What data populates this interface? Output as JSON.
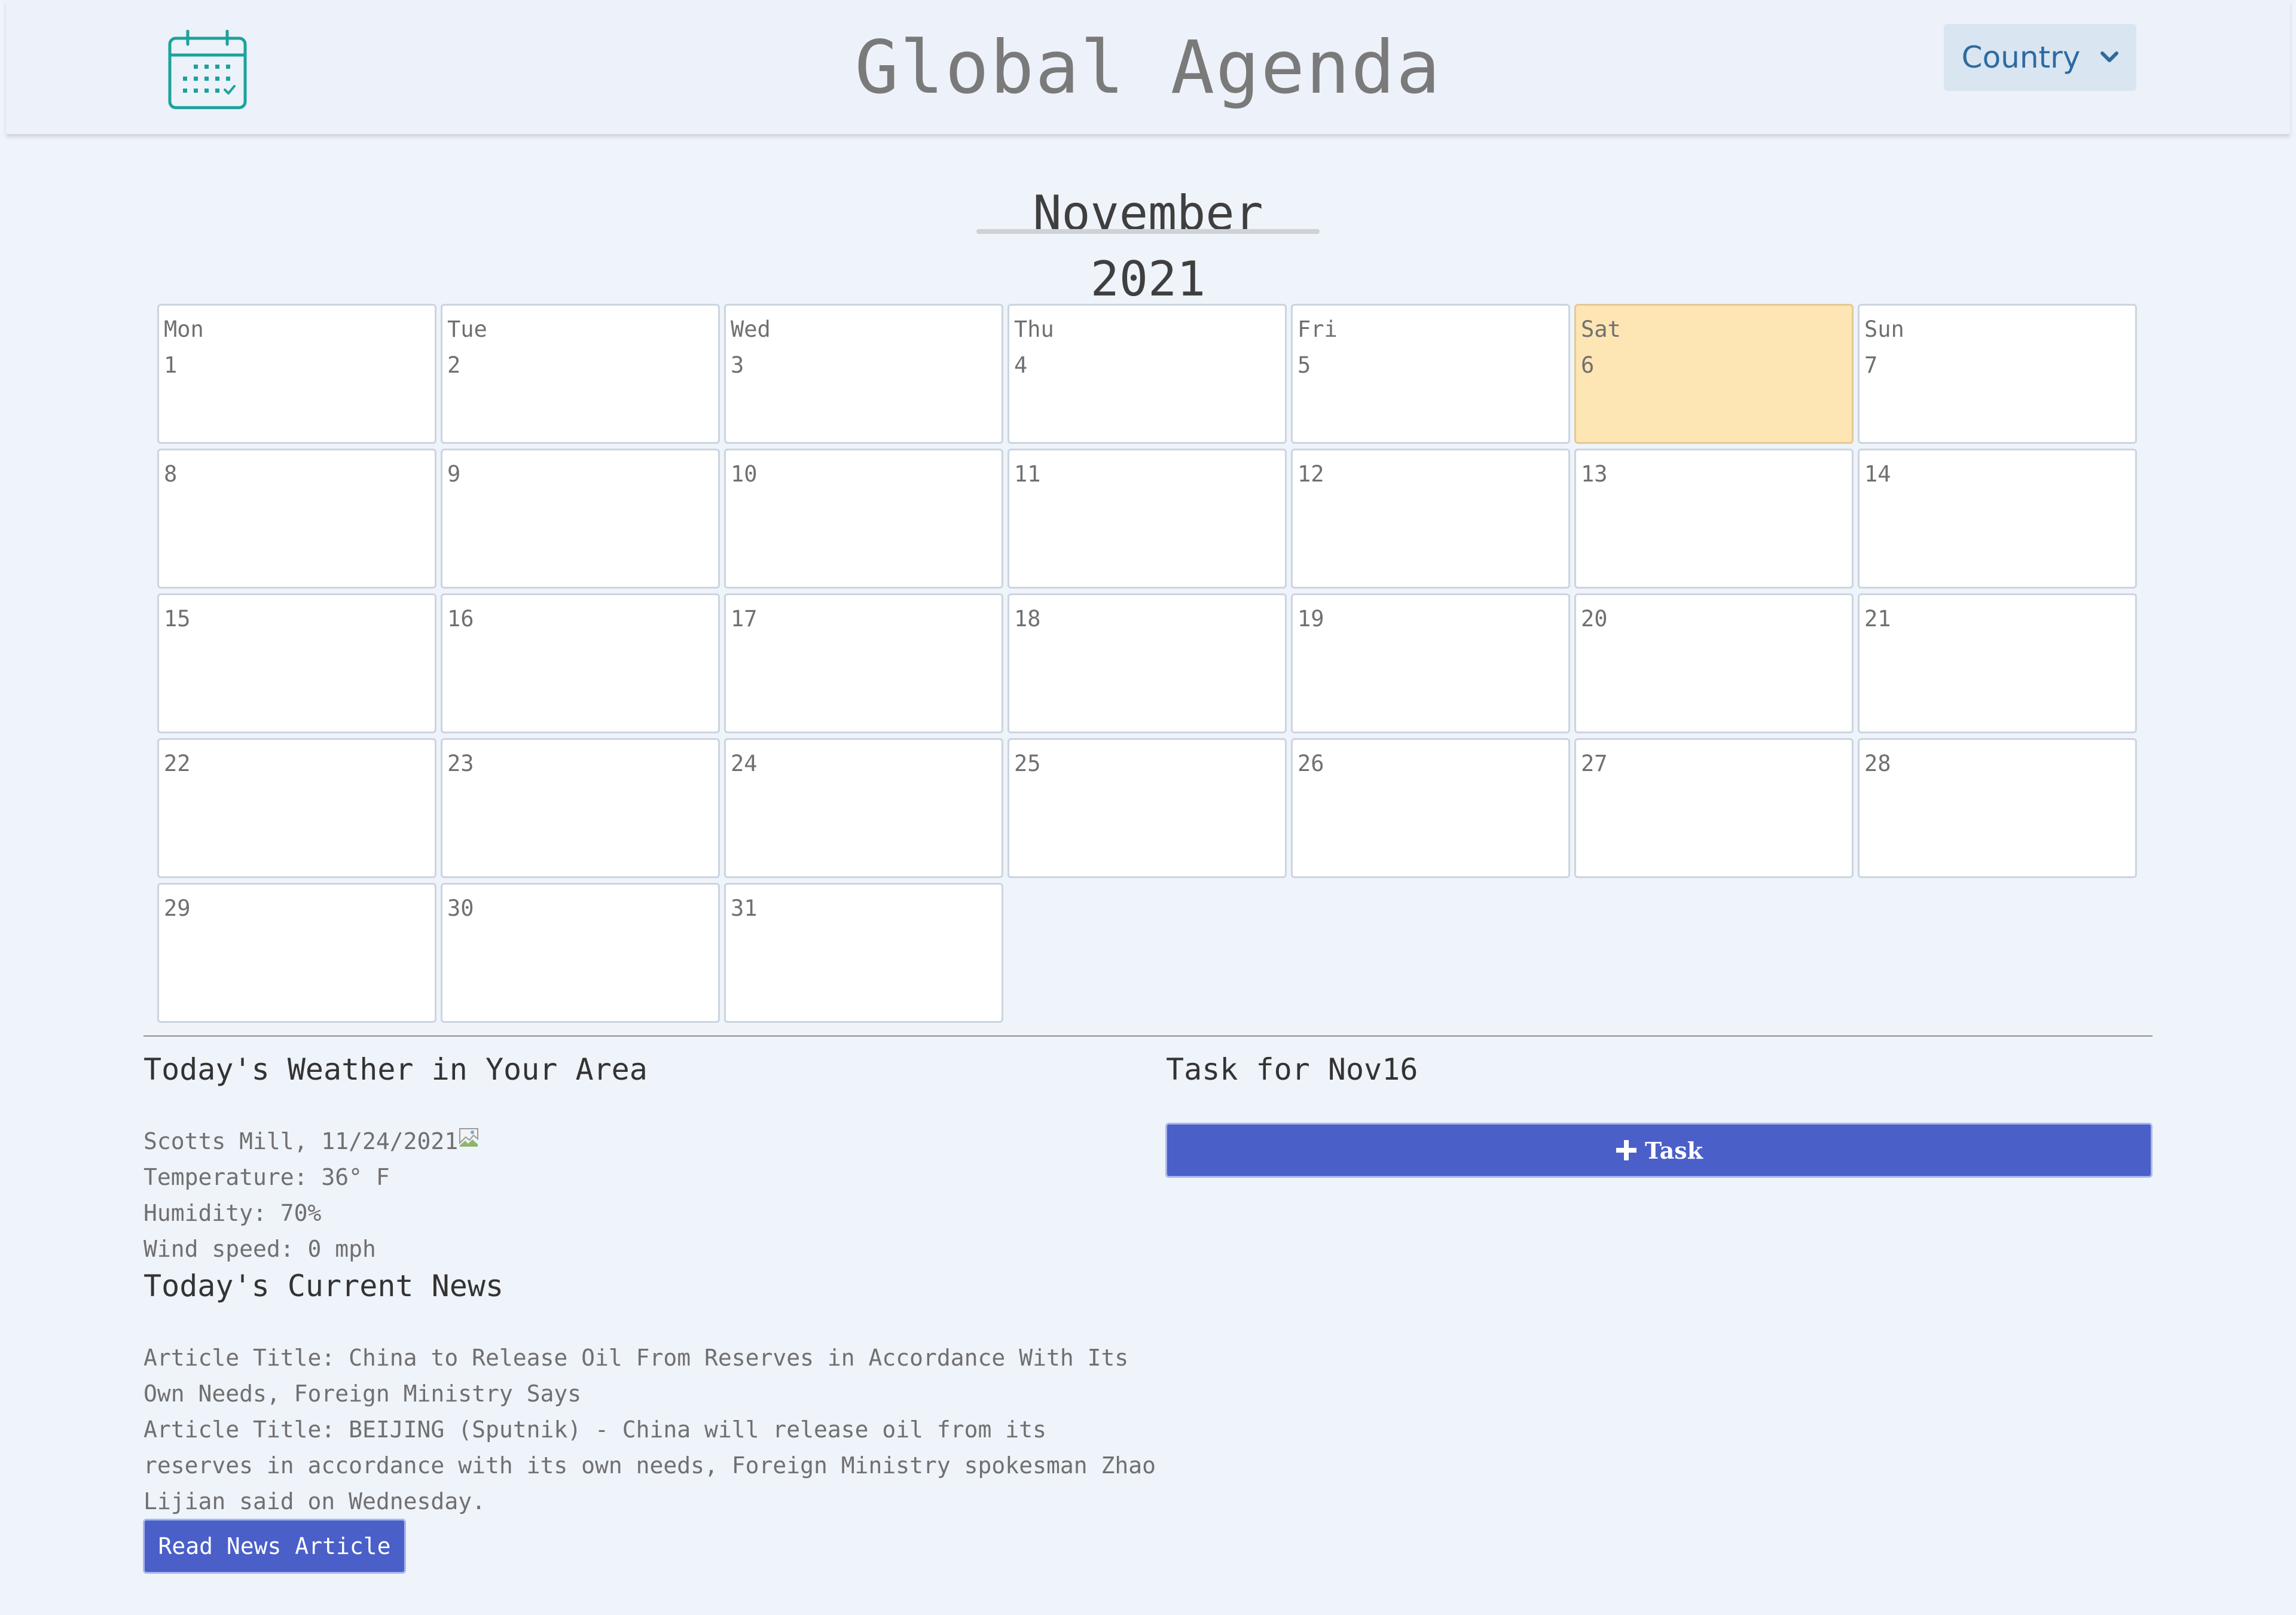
{
  "header": {
    "logo_icon": "calendar-icon",
    "title": "Global Agenda",
    "country_button": {
      "label": "Country",
      "icon": "chevron-down-icon"
    }
  },
  "calendar": {
    "month_title": "November 2021",
    "weekday_names": [
      "Mon",
      "Tue",
      "Wed",
      "Thu",
      "Fri",
      "Sat",
      "Sun"
    ],
    "days": [
      "1",
      "2",
      "3",
      "4",
      "5",
      "6",
      "7",
      "8",
      "9",
      "10",
      "11",
      "12",
      "13",
      "14",
      "15",
      "16",
      "17",
      "18",
      "19",
      "20",
      "21",
      "22",
      "23",
      "24",
      "25",
      "26",
      "27",
      "28",
      "29",
      "30",
      "31"
    ],
    "highlighted_day": "6",
    "highlight_color": "#fee5b4"
  },
  "weather": {
    "title": "Today's Weather in Your Area",
    "location_date": "Scotts Mill, 11/24/2021",
    "temperature": "Temperature: 36° F",
    "humidity": "Humidity: 70%",
    "wind": "Wind speed: 0 mph",
    "icon": "broken-image-icon"
  },
  "tasks": {
    "title": "Task for Nov16",
    "add_button_label": "Task",
    "add_button_icon": "plus-icon"
  },
  "news": {
    "title": "Today's Current News",
    "article_title": "Article Title: China to Release Oil From Reserves in Accordance With Its Own Needs, Foreign Ministry Says",
    "article_summary": "Article Title: BEIJING (Sputnik) - China will release oil from its reserves in accordance with its own needs, Foreign Ministry spokesman Zhao Lijian said on Wednesday.",
    "read_button_label": "Read News Article"
  },
  "colors": {
    "primary_button": "#4a5fc8",
    "country_button_bg": "#d9e5f1",
    "country_button_text": "#2c6ba2",
    "logo_teal": "#1aa39b"
  }
}
